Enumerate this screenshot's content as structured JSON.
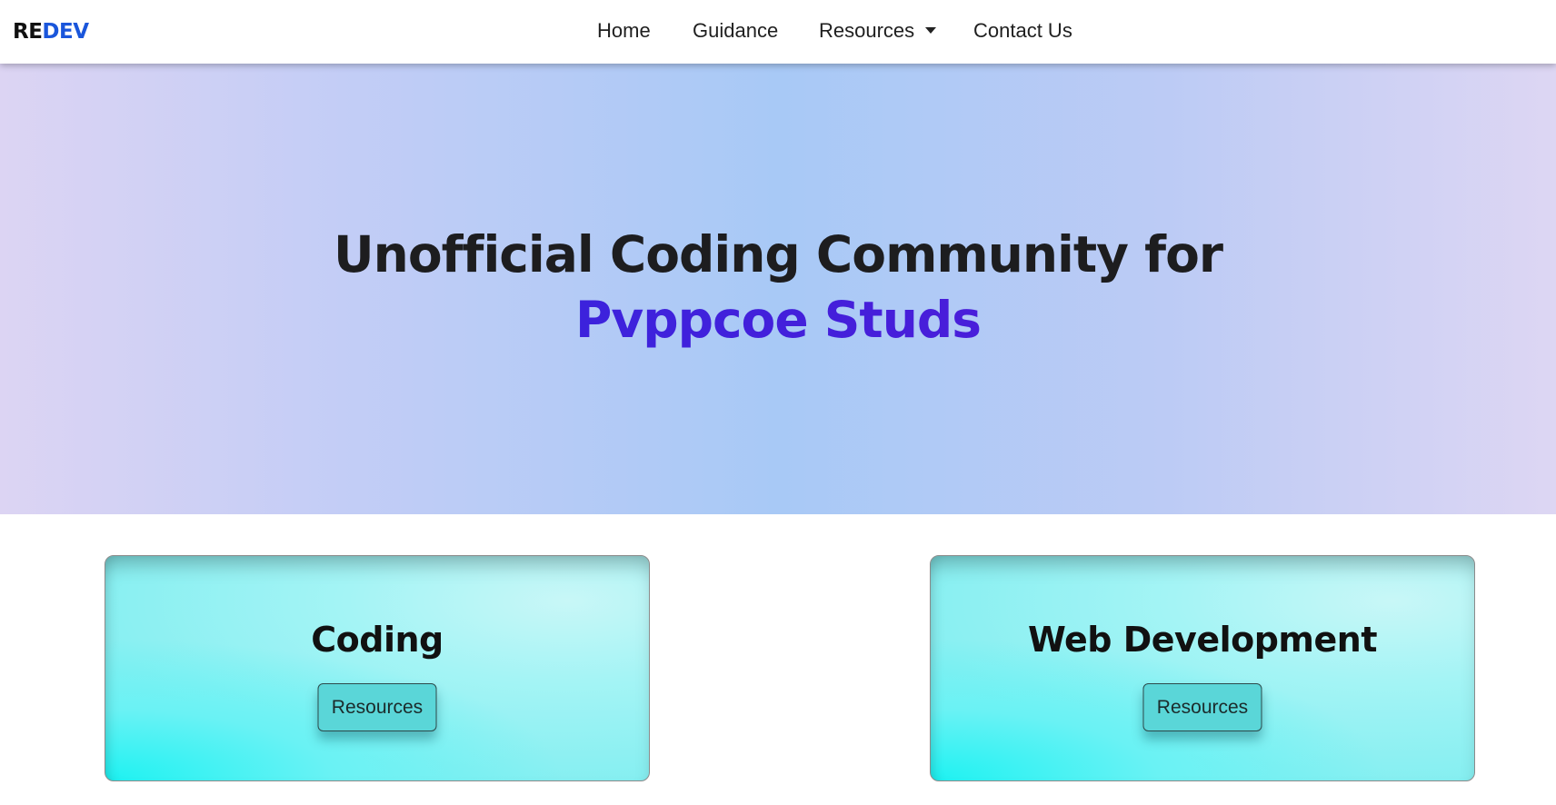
{
  "navbar": {
    "brand_part1": "RE",
    "brand_part2": "DEV",
    "brand_color": "#1a56db",
    "links": [
      {
        "label": "Home"
      },
      {
        "label": "Guidance"
      },
      {
        "label": "Resources",
        "has_dropdown": true,
        "icon": "caret-down-icon"
      },
      {
        "label": "Contact Us"
      }
    ]
  },
  "hero": {
    "title_line1": "Unofficial Coding Community for",
    "title_line2": "Pvppcoe Studs",
    "accent_color": "#3a1fdc"
  },
  "cards": [
    {
      "title": "Coding",
      "button_label": "Resources"
    },
    {
      "title": "Web Development",
      "button_label": "Resources"
    }
  ]
}
